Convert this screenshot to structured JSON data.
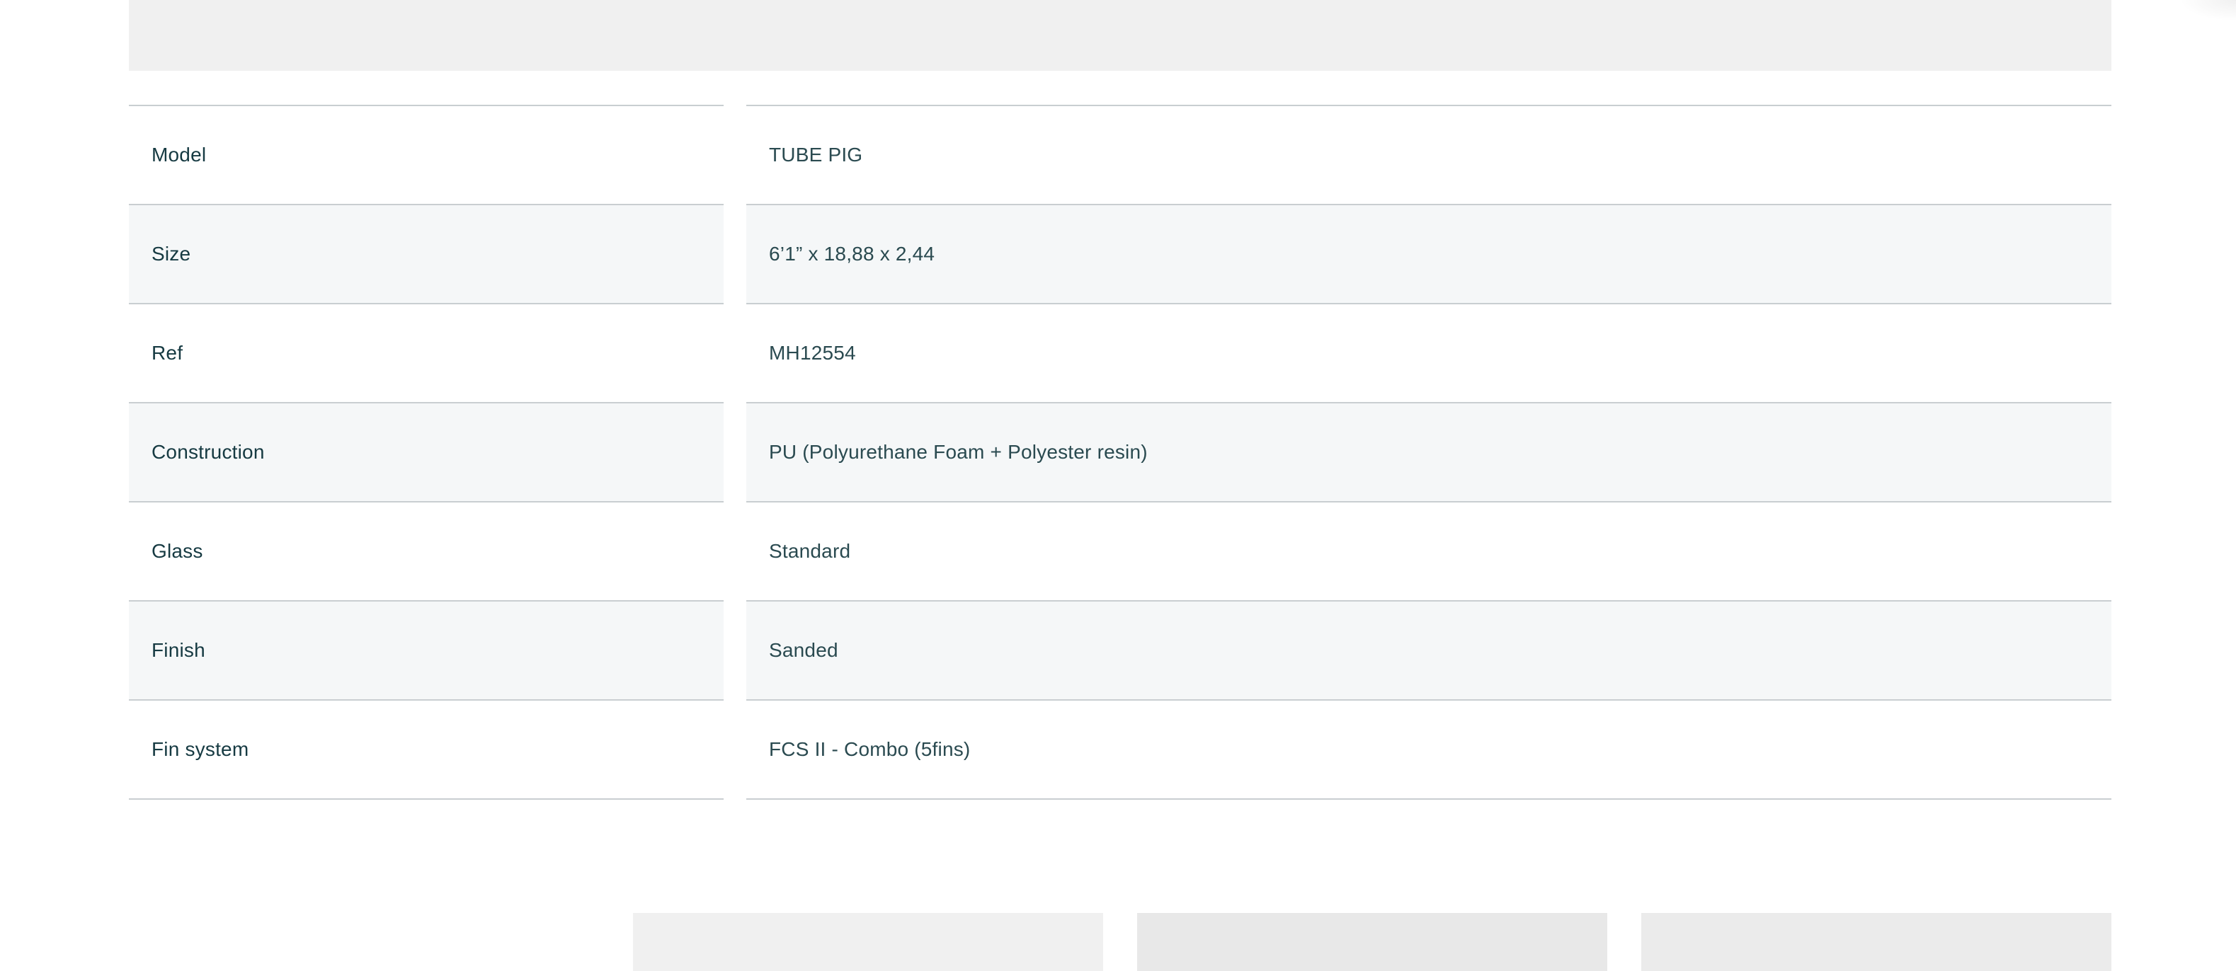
{
  "specs": {
    "rows": [
      {
        "label": "Model",
        "value": "TUBE PIG"
      },
      {
        "label": "Size",
        "value": "6’1” x 18,88 x 2,44"
      },
      {
        "label": "Ref",
        "value": "MH12554"
      },
      {
        "label": "Construction",
        "value": "PU (Polyurethane Foam + Polyester resin)"
      },
      {
        "label": "Glass",
        "value": "Standard"
      },
      {
        "label": "Finish",
        "value": "Sanded"
      },
      {
        "label": "Fin system",
        "value": "FCS II - Combo (5fins)"
      }
    ]
  },
  "colors": {
    "text": "#1c3d44",
    "row_alt_background": "#f5f7f8",
    "divider": "#c9ced1",
    "placeholder": "#f0f0f0"
  }
}
